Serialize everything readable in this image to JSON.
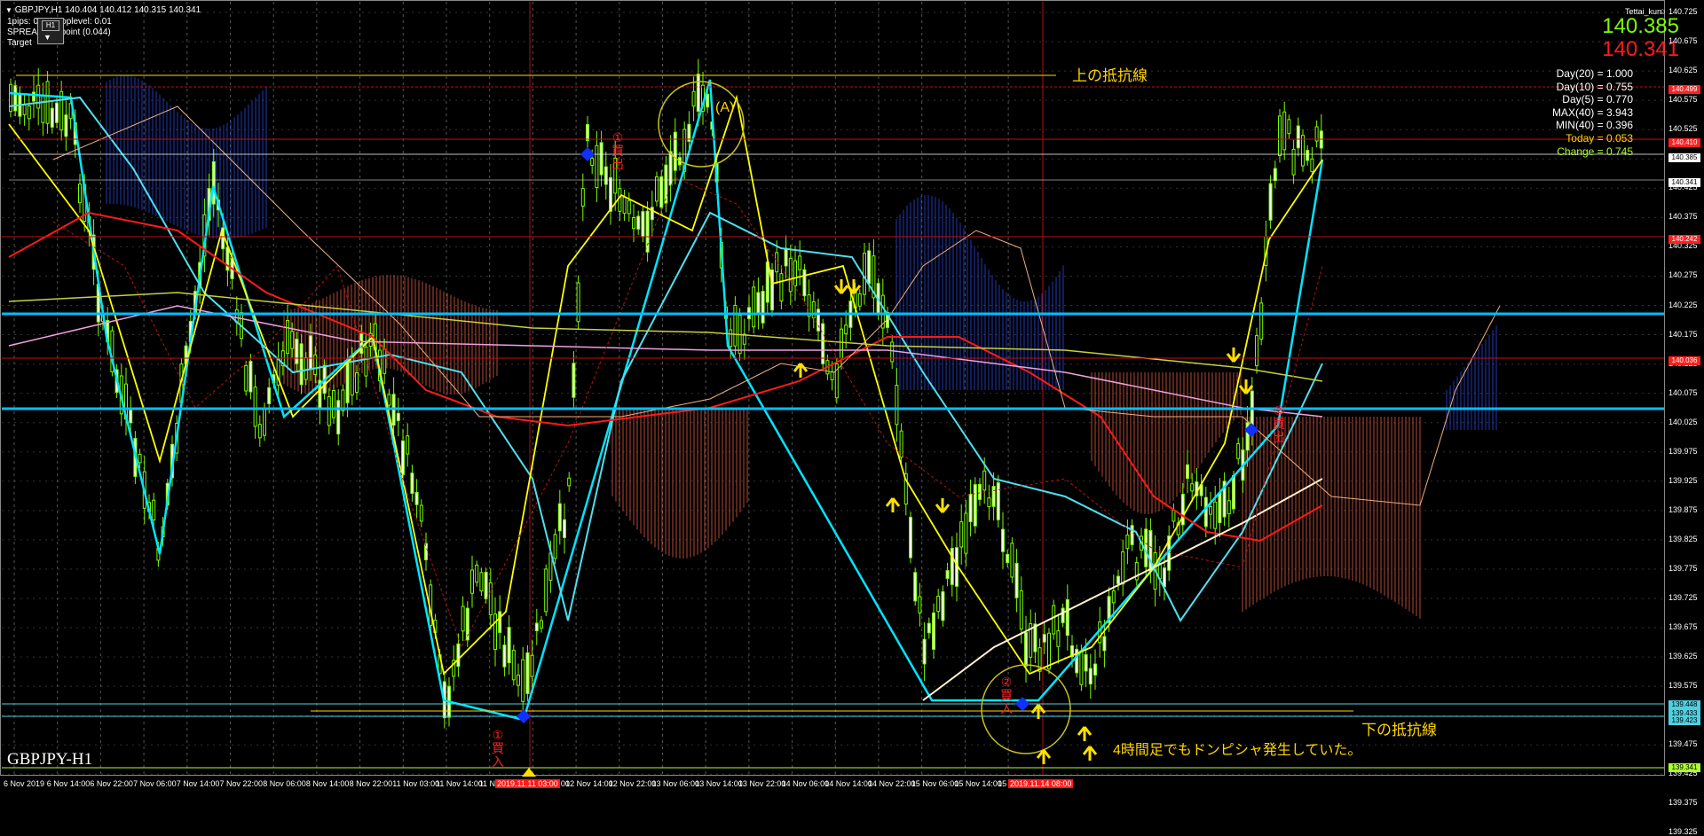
{
  "header": {
    "symbol_line": "GBPJPY,H1  140.404 140.412 140.315 140.341",
    "info_lines": [
      "1pips: 0.01 Stoplevel: 0.01",
      "SPREAD: 4.4point (0.044)",
      "Target"
    ],
    "account": "Tettai_kun"
  },
  "prices": {
    "bid": "140.385",
    "ask": "140.341"
  },
  "stats": [
    {
      "text": "Day(20) = 1.000",
      "color": "#ffffff"
    },
    {
      "text": "Day(10) = 0.755",
      "color": "#ffffff"
    },
    {
      "text": "Day(5) = 0.770",
      "color": "#ffffff"
    },
    {
      "text": "MAX(40) = 3.943",
      "color": "#ffffff"
    },
    {
      "text": "MIN(40) = 0.396",
      "color": "#ffffff"
    },
    {
      "text": "Today = 0.053",
      "color": "#ffd700"
    },
    {
      "text": "Change = 0.745",
      "color": "#adff2f"
    }
  ],
  "price_axis": [
    "140.725",
    "140.675",
    "140.625",
    "140.575",
    "140.525",
    "140.475",
    "140.425",
    "140.375",
    "140.325",
    "140.275",
    "140.225",
    "140.175",
    "140.125",
    "140.075",
    "140.025",
    "139.975",
    "139.925",
    "139.875",
    "139.825",
    "139.775",
    "139.725",
    "139.675",
    "139.625",
    "139.575",
    "139.525",
    "139.475",
    "139.425",
    "139.375",
    "139.325"
  ],
  "price_tags": [
    {
      "text": "140.499",
      "bg": "#ff2020"
    },
    {
      "text": "140.410",
      "bg": "#ff2020"
    },
    {
      "text": "140.385",
      "bg": "#ffffff"
    },
    {
      "text": "140.341",
      "bg": "#ffffff"
    },
    {
      "text": "140.242",
      "bg": "#ff2020"
    },
    {
      "text": "140.036",
      "bg": "#ff2020"
    },
    {
      "text": "139.448",
      "bg": "#4fd0e0"
    },
    {
      "text": "139.433",
      "bg": "#4fd0e0"
    },
    {
      "text": "139.423",
      "bg": "#4fd0e0"
    },
    {
      "text": "139.341",
      "bg": "#adff2f"
    }
  ],
  "time_axis": [
    "6 Nov 2019",
    "6 Nov 14:00",
    "6 Nov 22:00",
    "7 Nov 06:00",
    "7 Nov 14:00",
    "7 Nov 22:00",
    "8 Nov 06:00",
    "8 Nov 14:00",
    "8 Nov 22:00",
    "11 Nov 03:00",
    "11 Nov 14:00",
    "11 Nov 22:00",
    "12 Nov 06:00",
    "12 Nov 14:00",
    "12 Nov 22:00",
    "13 Nov 06:00",
    "13 Nov 14:00",
    "13 Nov 22:00",
    "14 Nov 06:00",
    "14 Nov 14:00",
    "14 Nov 22:00",
    "15 Nov 06:00",
    "15 Nov 14:00",
    "15 Nov 22:00"
  ],
  "time_markers": [
    "2019.11.11 03:00",
    "2019.11.14 08:00"
  ],
  "annotations": {
    "upper_resistance": "上の抵抗線",
    "lower_resistance": "下の抵抗線",
    "label_a": "(A)",
    "note_4h": "4時間足でもドンピシャ発生していた。",
    "sell1": "①\n買\n出",
    "buy1": "①\n買\n入",
    "buy2": "②\n買\n入",
    "sell2": "②\n買\n出"
  },
  "watermark": "GBPJPY-H1",
  "colors": {
    "candle": "#7cfc00",
    "cyan_line": "#00e5ff",
    "yellow_line": "#ffff00",
    "red_line": "#ff1a1a",
    "resistance": "#00bfff",
    "cloud_red": "#ff6a4d",
    "cloud_blue": "#3050ff"
  }
}
